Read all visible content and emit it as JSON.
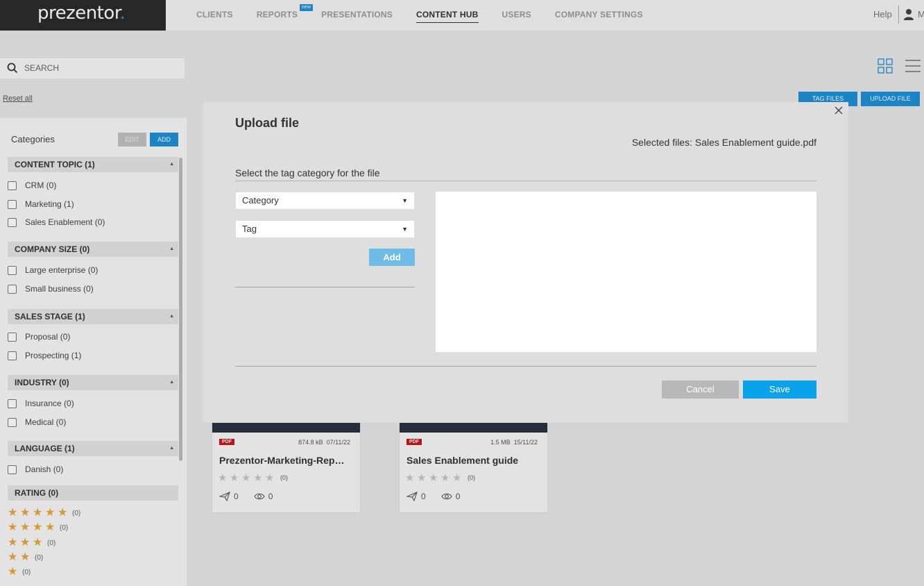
{
  "app": {
    "logo_text": "prezentor",
    "logo_dot": ".",
    "brand_color": "#1e90d6"
  },
  "nav": {
    "items": [
      {
        "label": "CLIENTS",
        "active": false
      },
      {
        "label": "REPORTS",
        "active": false,
        "badge": "new"
      },
      {
        "label": "PRESENTATIONS",
        "active": false
      },
      {
        "label": "CONTENT HUB",
        "active": true
      },
      {
        "label": "USERS",
        "active": false
      },
      {
        "label": "COMPANY SETTINGS",
        "active": false
      }
    ],
    "help": "Help",
    "user_initial": "M"
  },
  "search": {
    "placeholder": "SEARCH"
  },
  "sidebar": {
    "reset_all": "Reset all",
    "categories_title": "Categories",
    "edit_label": "EDIT",
    "add_label": "ADD",
    "groups": [
      {
        "title": "CONTENT TOPIC (1)",
        "items": [
          "CRM (0)",
          "Marketing (1)",
          "Sales Enablement (0)"
        ]
      },
      {
        "title": "COMPANY SIZE (0)",
        "items": [
          "Large enterprise (0)",
          "Small business (0)"
        ]
      },
      {
        "title": "SALES STAGE (1)",
        "items": [
          "Proposal (0)",
          "Prospecting (1)"
        ]
      },
      {
        "title": "INDUSTRY (0)",
        "items": [
          "Insurance (0)",
          "Medical (0)"
        ]
      },
      {
        "title": "LANGUAGE (1)",
        "items": [
          "Danish (0)"
        ]
      }
    ],
    "rating": {
      "title": "RATING (0)",
      "rows": [
        {
          "stars": 5,
          "count": "(0)"
        },
        {
          "stars": 4,
          "count": "(0)"
        },
        {
          "stars": 3,
          "count": "(0)"
        },
        {
          "stars": 2,
          "count": "(0)"
        },
        {
          "stars": 1,
          "count": "(0)"
        }
      ]
    }
  },
  "toolbar": {
    "tag_files": "TAG FILES",
    "upload_file": "UPLOAD FILE"
  },
  "cards": [
    {
      "type": "PDF",
      "size": "874.8 kB",
      "date": "07/11/22",
      "name": "Prezentor-Marketing-Rep…",
      "rating_count": "(0)",
      "shares": "0",
      "views": "0"
    },
    {
      "type": "PDF",
      "size": "1.5 MB",
      "date": "15/11/22",
      "name": "Sales Enablement guide",
      "rating_count": "(0)",
      "shares": "0",
      "views": "0"
    }
  ],
  "modal": {
    "title": "Upload file",
    "selected_files": "Selected files: Sales Enablement guide.pdf",
    "tag_category_label": "Select the tag category for the file",
    "category_value": "Category",
    "tag_value": "Tag",
    "add_label": "Add",
    "cancel_label": "Cancel",
    "save_label": "Save"
  }
}
